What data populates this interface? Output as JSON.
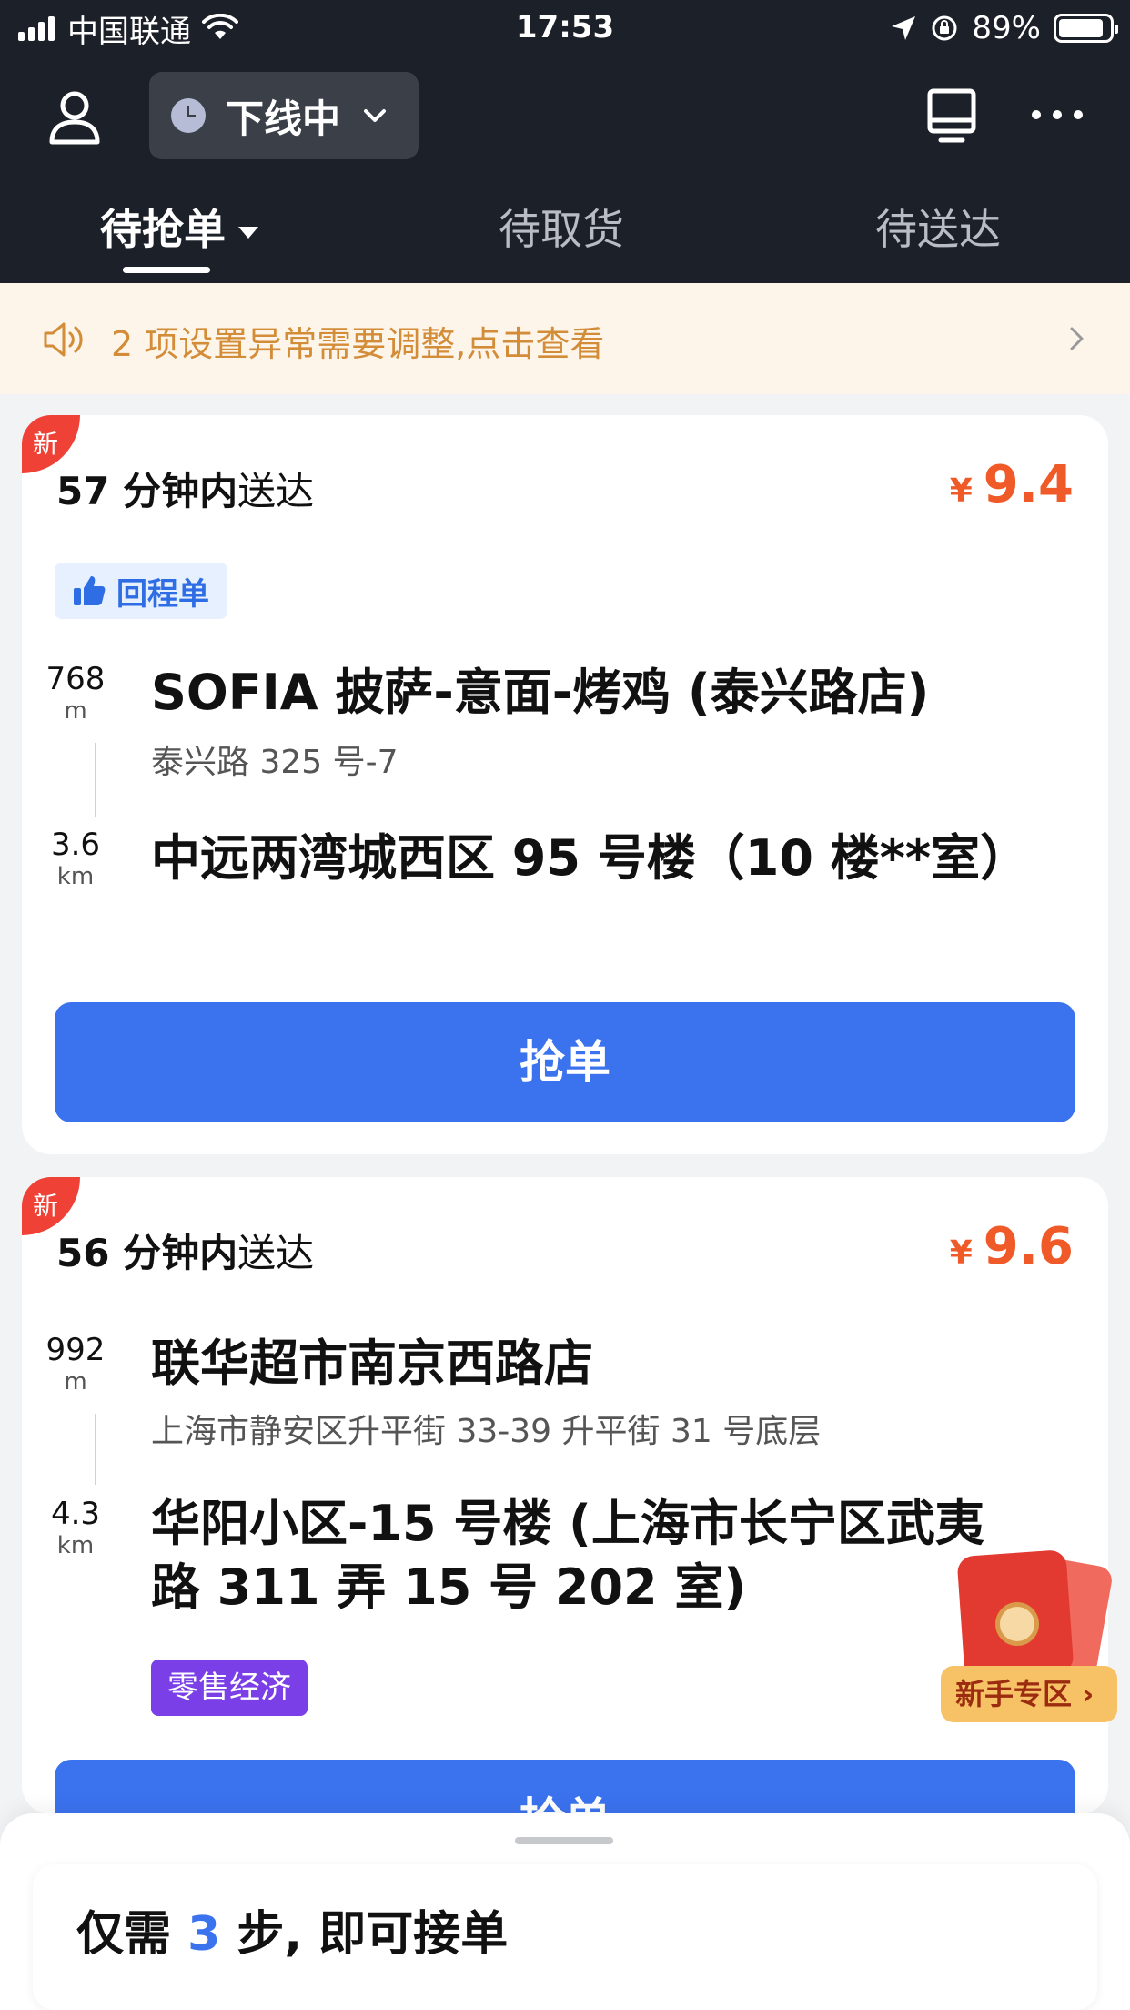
{
  "status_bar": {
    "carrier": "中国联通",
    "time": "17:53",
    "battery": "89%",
    "battery_level": 0.89
  },
  "header": {
    "online_status": "下线中",
    "tabs": [
      {
        "label": "待抢单",
        "active": true
      },
      {
        "label": "待取货",
        "active": false
      },
      {
        "label": "待送达",
        "active": false
      }
    ]
  },
  "notice": {
    "text": "2 项设置异常需要调整,点击查看"
  },
  "orders": [
    {
      "badge": "新",
      "deliver_time": "57 分钟内",
      "deliver_suffix": "送达",
      "currency": "¥",
      "price": "9.4",
      "tag": "回程单",
      "pickup_distance": "768",
      "pickup_unit": "m",
      "pickup_name": "SOFIA 披萨-意面-烤鸡 (泰兴路店)",
      "pickup_address": "泰兴路 325 号-7",
      "dropoff_distance": "3.6",
      "dropoff_unit": "km",
      "dropoff_name": "中远两湾城西区 95 号楼（10 楼**室）",
      "button": "抢单"
    },
    {
      "badge": "新",
      "deliver_time": "56 分钟内",
      "deliver_suffix": "送达",
      "currency": "¥",
      "price": "9.6",
      "pickup_distance": "992",
      "pickup_unit": "m",
      "pickup_name": "联华超市南京西路店",
      "pickup_address": "上海市静安区升平街 33-39 升平街 31 号底层",
      "dropoff_distance": "4.3",
      "dropoff_unit": "km",
      "dropoff_name": "华阳小区-15 号楼 (上海市长宁区武夷路 311 弄 15 号 202 室)",
      "category_tag": "零售经济",
      "button": "抢单"
    }
  ],
  "newbie_widget": {
    "label": "新手专区"
  },
  "bottom_sheet": {
    "title_prefix": "仅需",
    "steps": "3",
    "title_suffix": "步, 即可接单"
  },
  "colors": {
    "header_bg": "#1c2029",
    "accent_blue": "#3b72ee",
    "price_orange": "#f05a28",
    "notice_bg": "#fdf5e9",
    "notice_text": "#d38c37",
    "new_badge": "#ef4136",
    "retail_tag": "#7a3fe6"
  }
}
